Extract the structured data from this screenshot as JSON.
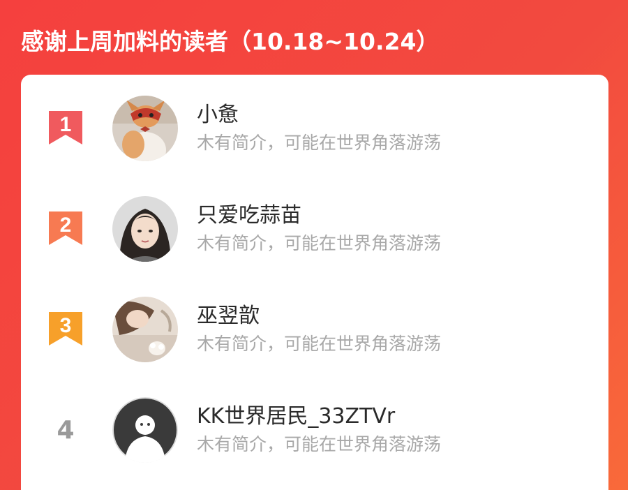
{
  "header": {
    "title": "感谢上周加料的读者（10.18~10.24）"
  },
  "readers": [
    {
      "rank": "1",
      "name": "小惫",
      "bio": "木有简介，可能在世界角落游荡",
      "badge_color": "#f05a5e",
      "avatar_icon": "cat-photo-icon"
    },
    {
      "rank": "2",
      "name": "只爱吃蒜苗",
      "bio": "木有简介，可能在世界角落游荡",
      "badge_color": "#f77a52",
      "avatar_icon": "woman-portrait-photo-icon"
    },
    {
      "rank": "3",
      "name": "巫翌歆",
      "bio": "木有简介，可能在世界角落游荡",
      "badge_color": "#f7a02a",
      "avatar_icon": "selfie-photo-icon"
    },
    {
      "rank": "4",
      "name": "KK世界居民_33ZTVr",
      "bio": "木有简介，可能在世界角落游荡",
      "badge_color": "",
      "avatar_icon": "default-user-avatar-icon"
    }
  ]
}
